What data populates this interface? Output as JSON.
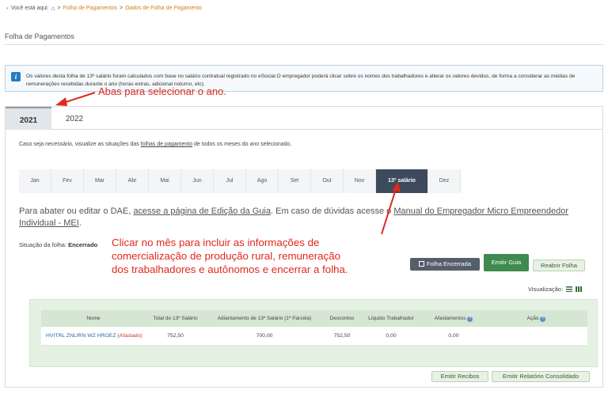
{
  "breadcrumb": {
    "prefix": "Você está aqui:",
    "sep1": ">",
    "item1": "Folha de Pagamentos",
    "sep2": ">",
    "item2": "Dados de Folha de Pagamento"
  },
  "page_title": "Folha de Pagamentos",
  "info": {
    "text": "Os valores desta folha de 13º salário foram calculados com base no salário contratual registrado no eSocial.O empregador poderá clicar sobre os nomes dos trabalhadores e alterar os valores devidos, de forma a considerar as médias de remunerações recebidas durante o ano (horas extras, adicional noturno, etc)."
  },
  "year_tabs": [
    {
      "label": "2021",
      "active": true
    },
    {
      "label": "2022",
      "active": false
    }
  ],
  "help": {
    "pre": "Caso seja necessário, visualize as situações das ",
    "link": "folhas de pagamento",
    "post": " de todos os meses do ano selecionado."
  },
  "months": [
    {
      "label": "Jan"
    },
    {
      "label": "Fev"
    },
    {
      "label": "Mar"
    },
    {
      "label": "Abr"
    },
    {
      "label": "Mai"
    },
    {
      "label": "Jun"
    },
    {
      "label": "Jul"
    },
    {
      "label": "Ago"
    },
    {
      "label": "Set"
    },
    {
      "label": "Out"
    },
    {
      "label": "Nov"
    },
    {
      "label": "13º salário",
      "active": true
    },
    {
      "label": "Dez"
    }
  ],
  "dae": {
    "pre": "Para abater ou editar o DAE, ",
    "link1": "acesse a página de Edição da Guia",
    "mid": ". Em caso de dúvidas acesse o ",
    "link2": "Manual do Empregador Micro Empreendedor Individual - MEI",
    "post": "."
  },
  "status": {
    "label": "Situação da folha:",
    "value": "Encerrado"
  },
  "buttons": {
    "folha_encerrada": "Folha Encerrada",
    "emitir_guia": "Emitir Guia",
    "reabrir_folha": "Reabrir Folha",
    "emitir_recibos": "Emitir Recibos",
    "emitir_relatorio": "Emitir Relatório Consolidado"
  },
  "view": {
    "label": "Visualização:"
  },
  "table": {
    "headers": [
      "Nome",
      "Total do 13º Salário",
      "Adiantamento de 13º Salário (1ª Parcela)",
      "Descontos",
      "Líquido Trabalhador",
      "Afastamentos",
      "Ação"
    ],
    "rows": [
      {
        "name": "HVITRL ZNLIRN WZ HROEZ",
        "tag": "(Afastado)",
        "total": "752,50",
        "adiantamento": "700,00",
        "descontos": "752,50",
        "liquido": "0,00",
        "afastamentos": "0,00",
        "acao": ""
      }
    ]
  },
  "annotations": {
    "tabs_note": "Abas para selecionar o ano.",
    "month_note_lines": [
      "Clicar no mês para incluir as informações de",
      "comercialização de produção rural, remuneração",
      "dos trabalhadores e autônomos e encerrar a folha."
    ],
    "color": "#e0281e"
  },
  "colors": {
    "accent_orange": "#d87d1a",
    "month_active": "#3d4a5c",
    "guia_green": "#3e8a4f",
    "table_bg": "#e5f2e3"
  }
}
